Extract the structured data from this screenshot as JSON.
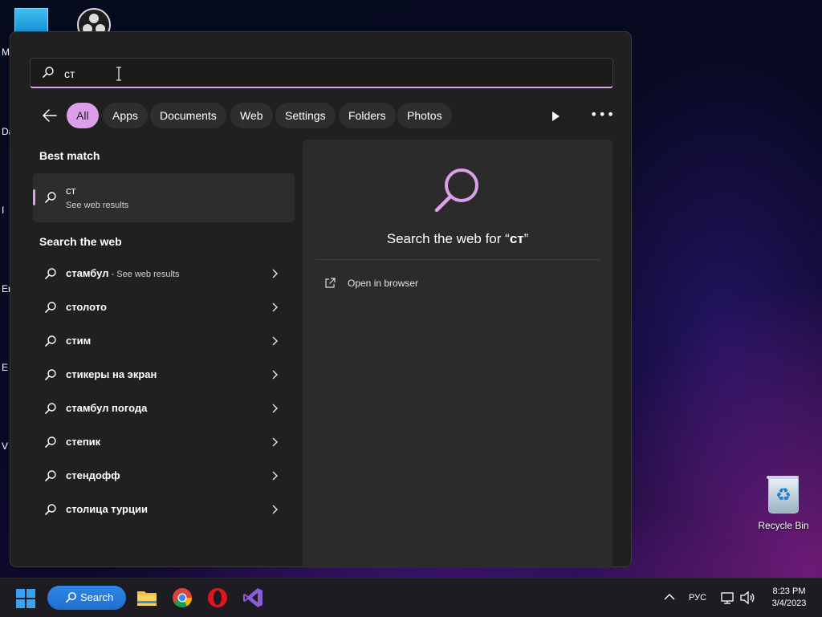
{
  "desktop": {
    "side_fragments": [
      "M",
      "Da",
      "I",
      "Er",
      "E",
      "V"
    ],
    "recycle_bin_label": "Recycle Bin"
  },
  "search": {
    "query": "ст"
  },
  "filters": {
    "chips": [
      "All",
      "Apps",
      "Documents",
      "Web",
      "Settings",
      "Folders",
      "Photos"
    ],
    "active": "All"
  },
  "results": {
    "best_match_title": "Best match",
    "best_match": {
      "title": "ст",
      "subtitle": "See web results"
    },
    "search_web_title": "Search the web",
    "web_items": [
      {
        "text": "стамбул",
        "suffix": " - See web results"
      },
      {
        "text": "столото",
        "suffix": ""
      },
      {
        "text": "стим",
        "suffix": ""
      },
      {
        "text": "стикеры на экран",
        "suffix": ""
      },
      {
        "text": "стамбул погода",
        "suffix": ""
      },
      {
        "text": "степик",
        "suffix": ""
      },
      {
        "text": "стендофф",
        "suffix": ""
      },
      {
        "text": "столица турции",
        "suffix": ""
      }
    ]
  },
  "preview": {
    "title_prefix": "Search the web for “",
    "title_query": "ст",
    "title_suffix": "”",
    "open_in_browser": "Open in browser"
  },
  "taskbar": {
    "search_label": "Search",
    "language": "РУС",
    "time": "8:23 PM",
    "date": "3/4/2023"
  },
  "colors": {
    "accent": "#dd9fe9",
    "taskbar_search": "#1f6fd0",
    "panel_bg": "#202020"
  }
}
